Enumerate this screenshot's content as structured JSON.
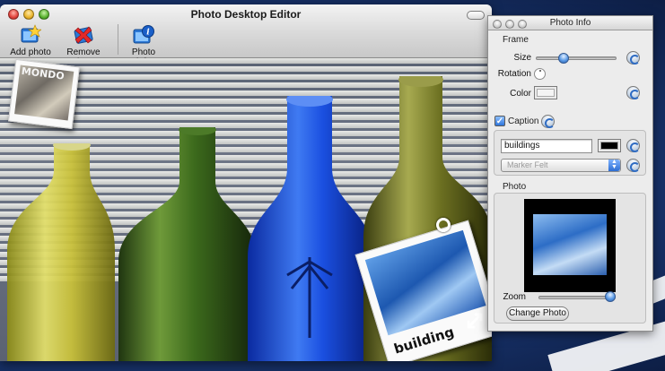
{
  "main_window": {
    "title": "Photo Desktop Editor",
    "toolbar": {
      "add_photo": "Add photo",
      "remove_photo": "Remove photo",
      "photo_info": "Photo info"
    },
    "canvas": {
      "small_frame_label": "MONDO",
      "caption_frame_text": "building"
    }
  },
  "info_panel": {
    "title": "Photo Info",
    "frame_group": {
      "label": "Frame",
      "size_label": "Size",
      "size_value": 0.32,
      "rotation_label": "Rotation",
      "color_label": "Color",
      "color_value": "#f4f4f4"
    },
    "caption_group": {
      "checkbox_label": "Caption",
      "checked": true,
      "text_value": "buildings",
      "text_color": "#000000",
      "font_popup_value": "Marker Felt"
    },
    "photo_group": {
      "label": "Photo",
      "zoom_label": "Zoom",
      "zoom_value": 1.0,
      "change_button": "Change Photo"
    }
  },
  "colors": {
    "accent_blue": "#2f6cc3",
    "window_chrome": "#d9d9d9",
    "desktop_blue": "#1c3a78"
  }
}
